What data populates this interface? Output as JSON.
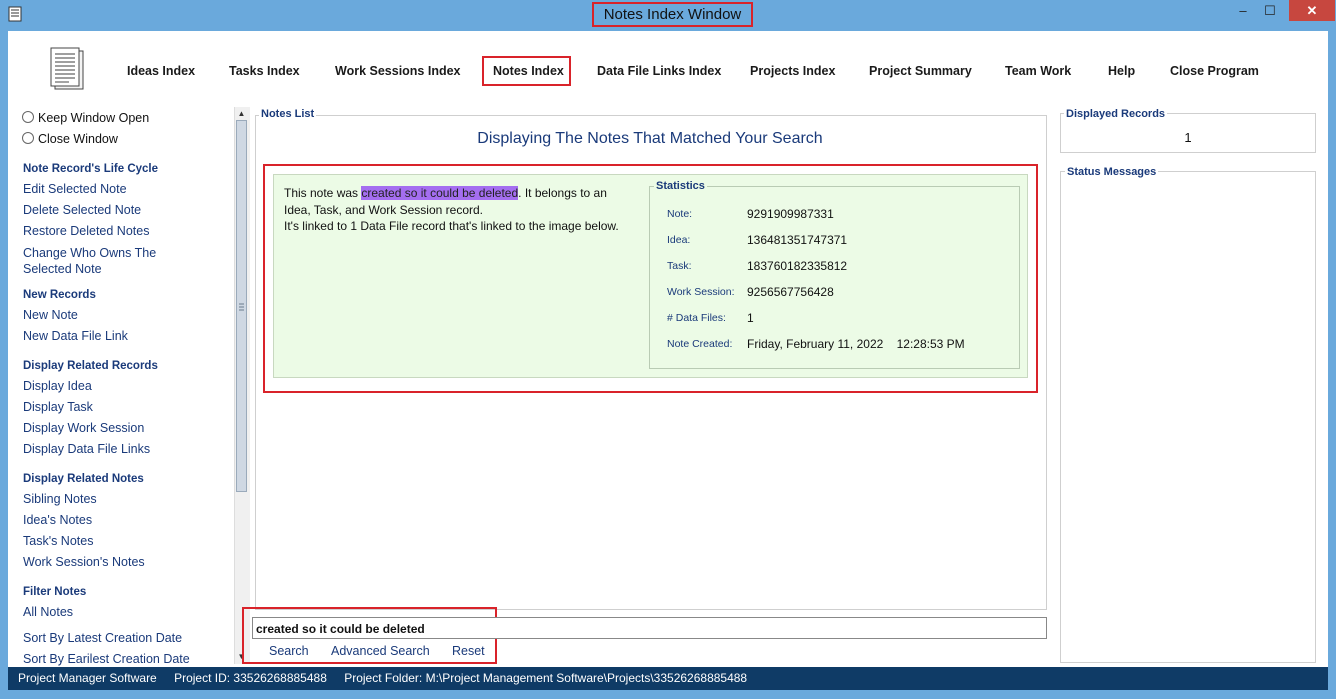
{
  "window": {
    "title": "Notes Index Window",
    "minimize": "–",
    "maximize": "☐",
    "close": "✕"
  },
  "nav": {
    "items": [
      {
        "label": "Ideas Index"
      },
      {
        "label": "Tasks Index"
      },
      {
        "label": "Work Sessions Index"
      },
      {
        "label": "Notes Index"
      },
      {
        "label": "Data File Links Index"
      },
      {
        "label": "Projects Index"
      },
      {
        "label": "Project Summary"
      },
      {
        "label": "Team Work"
      },
      {
        "label": "Help"
      },
      {
        "label": "Close Program"
      }
    ]
  },
  "sidebar": {
    "radio_keep_open": "Keep Window Open",
    "radio_close": "Close Window",
    "sections": [
      {
        "heading": "Note Record's Life Cycle",
        "links": [
          "Edit Selected Note",
          "Delete Selected Note",
          "Restore Deleted Notes",
          "Change Who Owns The",
          "Selected Note"
        ]
      },
      {
        "heading": "New Records",
        "links": [
          "New Note",
          "New Data File Link"
        ]
      },
      {
        "heading": "Display Related Records",
        "links": [
          "Display Idea",
          "Display Task",
          "Display Work Session",
          "Display Data File Links"
        ]
      },
      {
        "heading": "Display Related Notes",
        "links": [
          "Sibling Notes",
          "Idea's Notes",
          "Task's Notes",
          "Work Session's Notes"
        ]
      },
      {
        "heading": "Filter Notes",
        "links": [
          "All Notes",
          "Sort By Latest Creation Date",
          "Sort By Earilest Creation Date"
        ]
      }
    ]
  },
  "notes_list": {
    "label": "Notes List",
    "heading": "Displaying The Notes That Matched Your Search",
    "note": {
      "text_before": "This note was ",
      "highlight": "created so it could be deleted",
      "text_after": ". It belongs to an",
      "line2": "Idea, Task, and Work Session record.",
      "line3": "It's linked to 1 Data File record that's linked to the image below."
    },
    "statistics": {
      "title": "Statistics",
      "rows": [
        {
          "label": "Note:",
          "value": "9291909987331"
        },
        {
          "label": "Idea:",
          "value": "136481351747371"
        },
        {
          "label": "Task:",
          "value": "183760182335812"
        },
        {
          "label": "Work Session:",
          "value": "9256567756428"
        },
        {
          "label": "# Data Files:",
          "value": "1"
        },
        {
          "label": "Note Created:",
          "value": "Friday, February 11, 2022    12:28:53 PM"
        }
      ]
    }
  },
  "search": {
    "value": "created so it could be deleted",
    "search_label": "Search",
    "advanced_label": "Advanced Search",
    "reset_label": "Reset"
  },
  "right_panel": {
    "displayed_label": "Displayed Records",
    "displayed_value": "1",
    "status_label": "Status Messages"
  },
  "statusbar": {
    "app": "Project Manager Software",
    "project_id": "Project ID:  33526268885488",
    "project_folder": "Project Folder:  M:\\Project Management Software\\Projects\\33526268885488"
  }
}
